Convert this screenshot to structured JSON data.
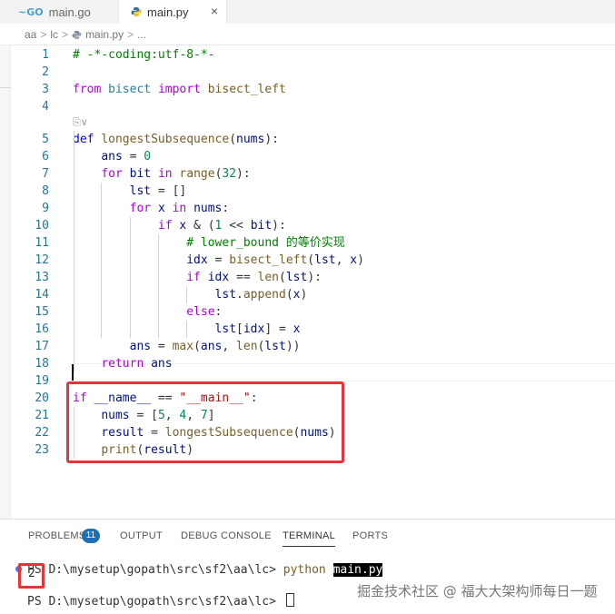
{
  "tabs": [
    {
      "label": "main.go",
      "icon": "go-file-icon"
    },
    {
      "label": "main.py",
      "icon": "python-file-icon",
      "active": true,
      "close": "×"
    }
  ],
  "go_icon_text": "~GO",
  "breadcrumb": [
    "aa",
    "lc",
    "main.py",
    "..."
  ],
  "codelens": "⎘∨",
  "code_lines": [
    {
      "n": "1",
      "tokens": [
        [
          "cm",
          "# -*-coding:utf-8-*-"
        ]
      ]
    },
    {
      "n": "2",
      "tokens": []
    },
    {
      "n": "3",
      "tokens": [
        [
          "kw2",
          "from"
        ],
        [
          "pl",
          " "
        ],
        [
          "bi",
          "bisect"
        ],
        [
          "pl",
          " "
        ],
        [
          "kw2",
          "import"
        ],
        [
          "pl",
          " "
        ],
        [
          "fn",
          "bisect_left"
        ]
      ]
    },
    {
      "n": "4",
      "tokens": []
    },
    {
      "n": "5",
      "tokens": [
        [
          "kw",
          "def"
        ],
        [
          "pl",
          " "
        ],
        [
          "fn",
          "longestSubsequence"
        ],
        [
          "pl",
          "("
        ],
        [
          "var",
          "nums"
        ],
        [
          "pl",
          "):"
        ]
      ]
    },
    {
      "n": "6",
      "tokens": [
        [
          "pl",
          "    "
        ],
        [
          "var",
          "ans"
        ],
        [
          "pl",
          " = "
        ],
        [
          "num",
          "0"
        ]
      ]
    },
    {
      "n": "7",
      "tokens": [
        [
          "pl",
          "    "
        ],
        [
          "kw2",
          "for"
        ],
        [
          "pl",
          " "
        ],
        [
          "var",
          "bit"
        ],
        [
          "pl",
          " "
        ],
        [
          "kw2",
          "in"
        ],
        [
          "pl",
          " "
        ],
        [
          "fn",
          "range"
        ],
        [
          "pl",
          "("
        ],
        [
          "num",
          "32"
        ],
        [
          "pl",
          "):"
        ]
      ]
    },
    {
      "n": "8",
      "tokens": [
        [
          "pl",
          "        "
        ],
        [
          "var",
          "lst"
        ],
        [
          "pl",
          " = []"
        ]
      ]
    },
    {
      "n": "9",
      "tokens": [
        [
          "pl",
          "        "
        ],
        [
          "kw2",
          "for"
        ],
        [
          "pl",
          " "
        ],
        [
          "var",
          "x"
        ],
        [
          "pl",
          " "
        ],
        [
          "kw2",
          "in"
        ],
        [
          "pl",
          " "
        ],
        [
          "var",
          "nums"
        ],
        [
          "pl",
          ":"
        ]
      ]
    },
    {
      "n": "10",
      "tokens": [
        [
          "pl",
          "            "
        ],
        [
          "kw2",
          "if"
        ],
        [
          "pl",
          " "
        ],
        [
          "var",
          "x"
        ],
        [
          "pl",
          " & ("
        ],
        [
          "num",
          "1"
        ],
        [
          "pl",
          " << "
        ],
        [
          "var",
          "bit"
        ],
        [
          "pl",
          "):"
        ]
      ]
    },
    {
      "n": "11",
      "tokens": [
        [
          "pl",
          "                "
        ],
        [
          "cm",
          "# lower_bound 的等价实现"
        ]
      ]
    },
    {
      "n": "12",
      "tokens": [
        [
          "pl",
          "                "
        ],
        [
          "var",
          "idx"
        ],
        [
          "pl",
          " = "
        ],
        [
          "fn",
          "bisect_left"
        ],
        [
          "pl",
          "("
        ],
        [
          "var",
          "lst"
        ],
        [
          "pl",
          ", "
        ],
        [
          "var",
          "x"
        ],
        [
          "pl",
          ")"
        ]
      ]
    },
    {
      "n": "13",
      "tokens": [
        [
          "pl",
          "                "
        ],
        [
          "kw2",
          "if"
        ],
        [
          "pl",
          " "
        ],
        [
          "var",
          "idx"
        ],
        [
          "pl",
          " == "
        ],
        [
          "fn",
          "len"
        ],
        [
          "pl",
          "("
        ],
        [
          "var",
          "lst"
        ],
        [
          "pl",
          "):"
        ]
      ]
    },
    {
      "n": "14",
      "tokens": [
        [
          "pl",
          "                    "
        ],
        [
          "var",
          "lst"
        ],
        [
          "pl",
          "."
        ],
        [
          "fn",
          "append"
        ],
        [
          "pl",
          "("
        ],
        [
          "var",
          "x"
        ],
        [
          "pl",
          ")"
        ]
      ]
    },
    {
      "n": "15",
      "tokens": [
        [
          "pl",
          "                "
        ],
        [
          "kw2",
          "else"
        ],
        [
          "pl",
          ":"
        ]
      ]
    },
    {
      "n": "16",
      "tokens": [
        [
          "pl",
          "                    "
        ],
        [
          "var",
          "lst"
        ],
        [
          "pl",
          "["
        ],
        [
          "var",
          "idx"
        ],
        [
          "pl",
          "] = "
        ],
        [
          "var",
          "x"
        ]
      ]
    },
    {
      "n": "17",
      "tokens": [
        [
          "pl",
          "        "
        ],
        [
          "var",
          "ans"
        ],
        [
          "pl",
          " = "
        ],
        [
          "fn",
          "max"
        ],
        [
          "pl",
          "("
        ],
        [
          "var",
          "ans"
        ],
        [
          "pl",
          ", "
        ],
        [
          "fn",
          "len"
        ],
        [
          "pl",
          "("
        ],
        [
          "var",
          "lst"
        ],
        [
          "pl",
          "))"
        ]
      ]
    },
    {
      "n": "18",
      "tokens": [
        [
          "pl",
          "    "
        ],
        [
          "kw2",
          "return"
        ],
        [
          "pl",
          " "
        ],
        [
          "var",
          "ans"
        ]
      ]
    },
    {
      "n": "19",
      "tokens": []
    },
    {
      "n": "20",
      "tokens": [
        [
          "kw2",
          "if"
        ],
        [
          "pl",
          " "
        ],
        [
          "var",
          "__name__"
        ],
        [
          "pl",
          " == "
        ],
        [
          "str",
          "\"__main__\""
        ],
        [
          "pl",
          ":"
        ]
      ]
    },
    {
      "n": "21",
      "tokens": [
        [
          "pl",
          "    "
        ],
        [
          "var",
          "nums"
        ],
        [
          "pl",
          " = ["
        ],
        [
          "num",
          "5"
        ],
        [
          "pl",
          ", "
        ],
        [
          "num",
          "4"
        ],
        [
          "pl",
          ", "
        ],
        [
          "num",
          "7"
        ],
        [
          "pl",
          "]"
        ]
      ]
    },
    {
      "n": "22",
      "tokens": [
        [
          "pl",
          "    "
        ],
        [
          "var",
          "result"
        ],
        [
          "pl",
          " = "
        ],
        [
          "fn",
          "longestSubsequence"
        ],
        [
          "pl",
          "("
        ],
        [
          "var",
          "nums"
        ],
        [
          "pl",
          ")"
        ]
      ]
    },
    {
      "n": "23",
      "tokens": [
        [
          "pl",
          "    "
        ],
        [
          "fn",
          "print"
        ],
        [
          "pl",
          "("
        ],
        [
          "var",
          "result"
        ],
        [
          "pl",
          ")"
        ]
      ]
    }
  ],
  "panel": {
    "tabs": [
      "PROBLEMS",
      "OUTPUT",
      "DEBUG CONSOLE",
      "TERMINAL",
      "PORTS"
    ],
    "active_tab": "TERMINAL",
    "problems_count": "11",
    "terminal": {
      "prompt1": "PS D:\\mysetup\\gopath\\src\\sf2\\aa\\lc> ",
      "cmd": "python",
      "arg": "main.py",
      "output": "2",
      "prompt2": "PS D:\\mysetup\\gopath\\src\\sf2\\aa\\lc> "
    }
  },
  "watermark": "掘金技术社区 @ 福大大架构师每日一题",
  "colors": {
    "highlight_box": "#e5343a",
    "badge": "#1f6fb2",
    "line_number": "#237893"
  }
}
